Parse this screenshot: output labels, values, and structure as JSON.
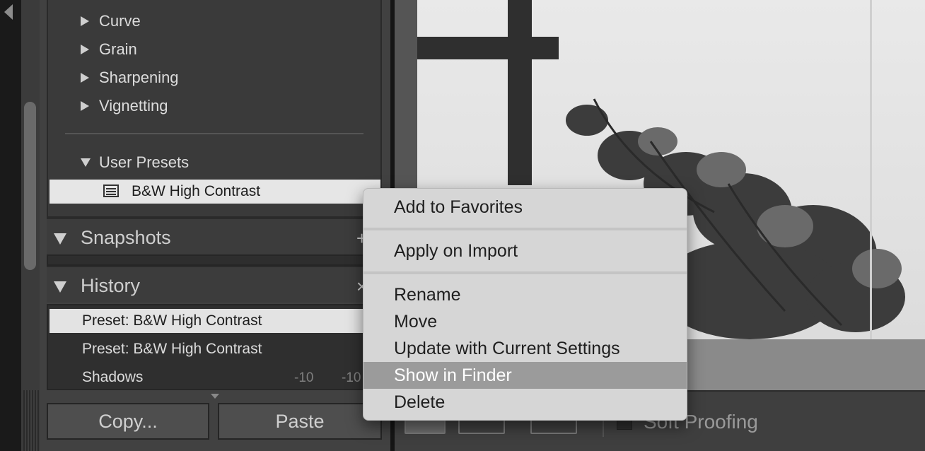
{
  "presets_panel": {
    "groups": [
      "Curve",
      "Grain",
      "Sharpening",
      "Vignetting"
    ],
    "user_presets_label": "User Presets",
    "selected_preset": "B&W High Contrast"
  },
  "snapshots": {
    "title": "Snapshots",
    "add_symbol": "+"
  },
  "history": {
    "title": "History",
    "clear_symbol": "×",
    "rows": [
      {
        "label": "Preset: B&W High Contrast"
      },
      {
        "label": "Preset: B&W High Contrast"
      },
      {
        "label": "Shadows",
        "value_a": "-10",
        "value_b": "-10"
      }
    ]
  },
  "buttons": {
    "copy": "Copy...",
    "paste": "Paste"
  },
  "toolbar": {
    "soft_proofing": "Soft Proofing"
  },
  "context_menu": {
    "items": [
      "Add to Favorites",
      "Apply on Import",
      "Rename",
      "Move",
      "Update with Current Settings",
      "Show in Finder",
      "Delete"
    ],
    "highlighted": "Show in Finder"
  }
}
